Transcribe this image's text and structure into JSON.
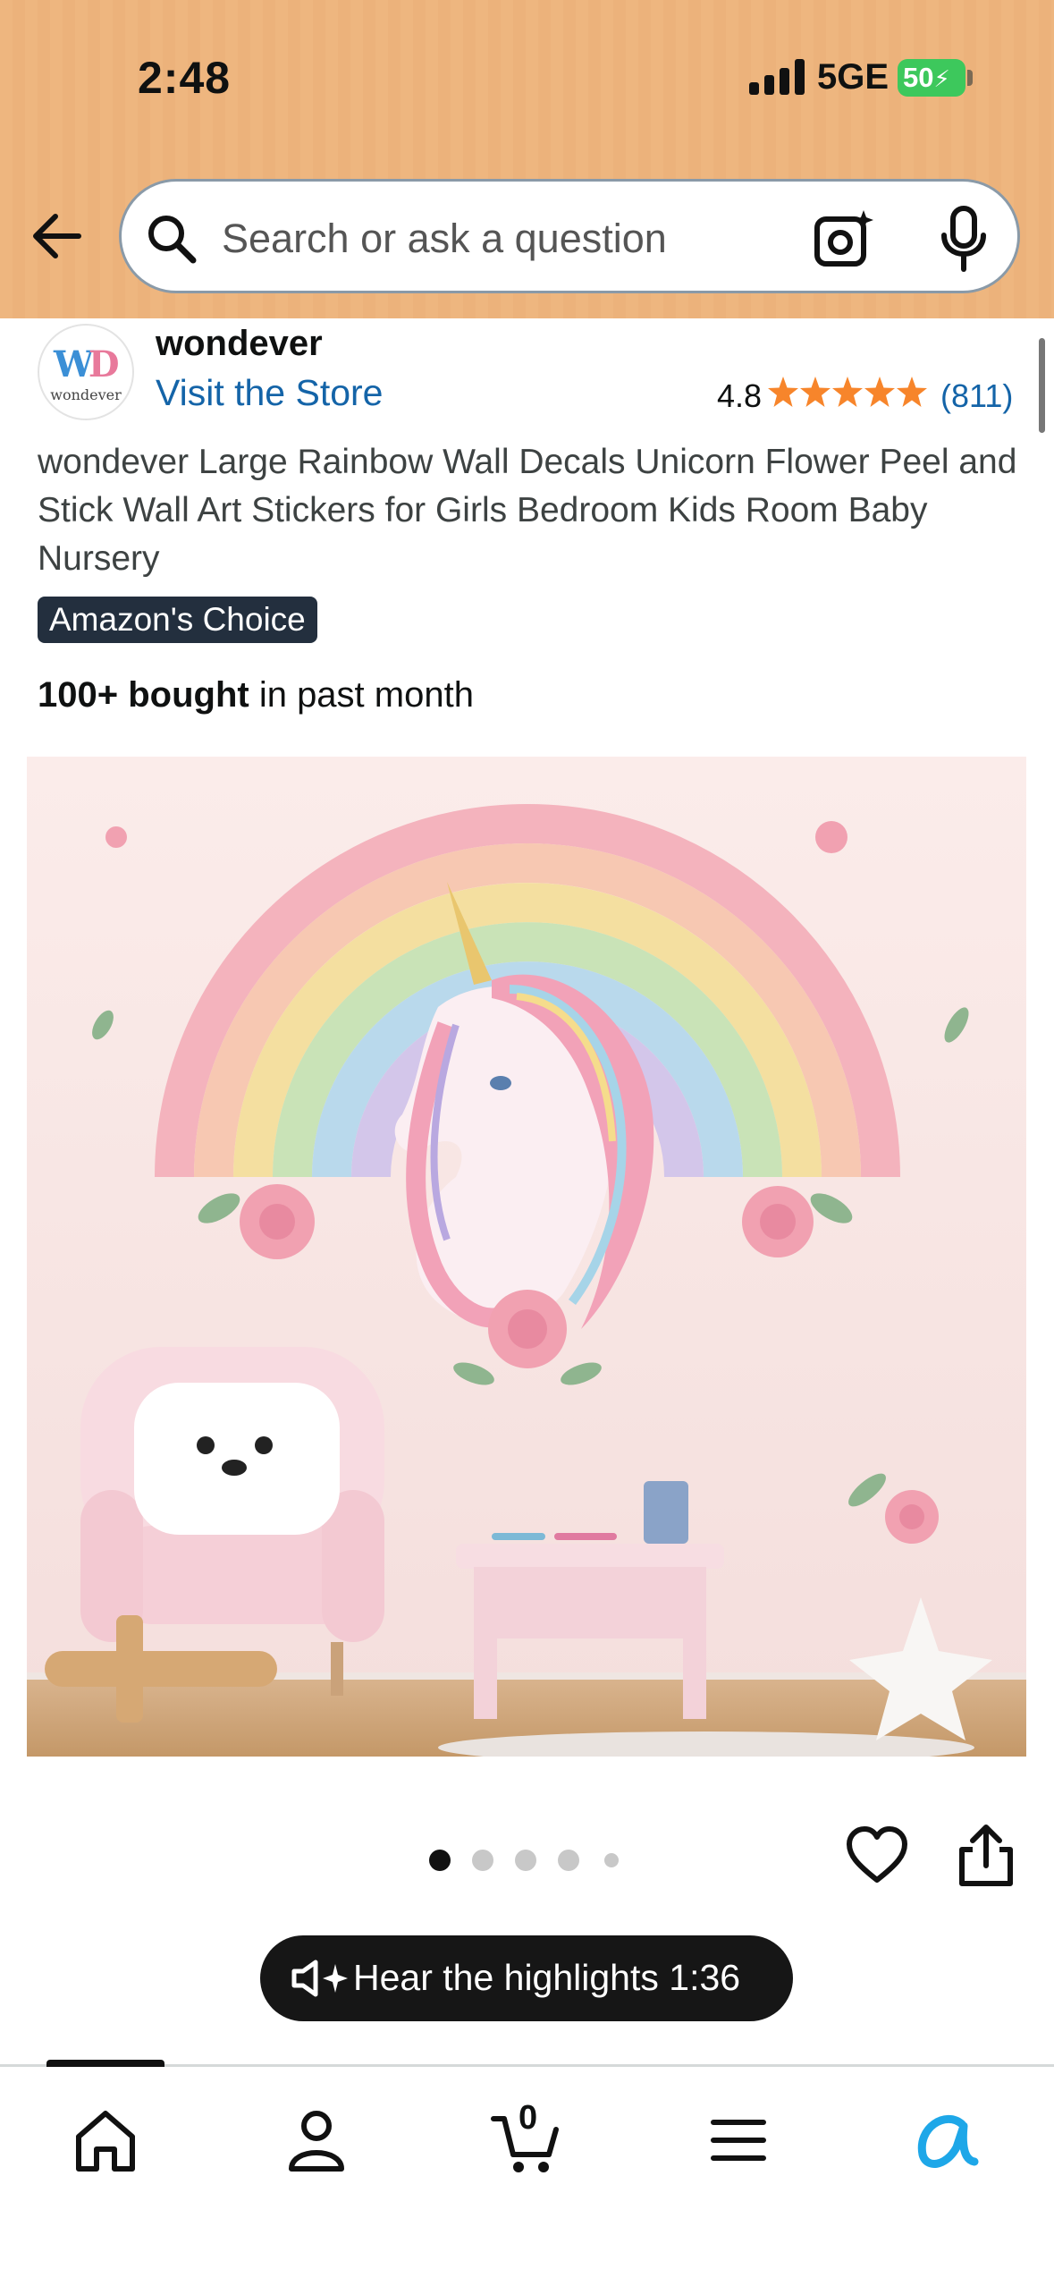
{
  "status_bar": {
    "time": "2:48",
    "network": "5GE",
    "battery": "50"
  },
  "search": {
    "placeholder": "Search or ask a question"
  },
  "store": {
    "name": "wondever",
    "visit_link": "Visit the Store",
    "rating": "4.8",
    "rating_stars": 5,
    "review_count": "(811)"
  },
  "product": {
    "title": "wondever Large Rainbow Wall Decals Unicorn Flower Peel and Stick Wall Art Stickers for Girls Bedroom Kids Room Baby Nursery",
    "badge": "Amazon's Choice",
    "bought_bold": "100+ bought",
    "bought_rest": " in past month",
    "image_count": 5,
    "active_image": 1
  },
  "audio": {
    "label": "Hear the highlights 1:36"
  },
  "bottom_nav": {
    "items": [
      "home-icon",
      "account-icon",
      "cart-icon",
      "menu-icon",
      "rufus-icon"
    ],
    "cart_count": "0"
  },
  "colors": {
    "header_bg": "#eeb67f",
    "link": "#1464a8",
    "star": "#f7852b",
    "badge_bg": "#232f3e",
    "rufus": "#1ea7e8"
  }
}
